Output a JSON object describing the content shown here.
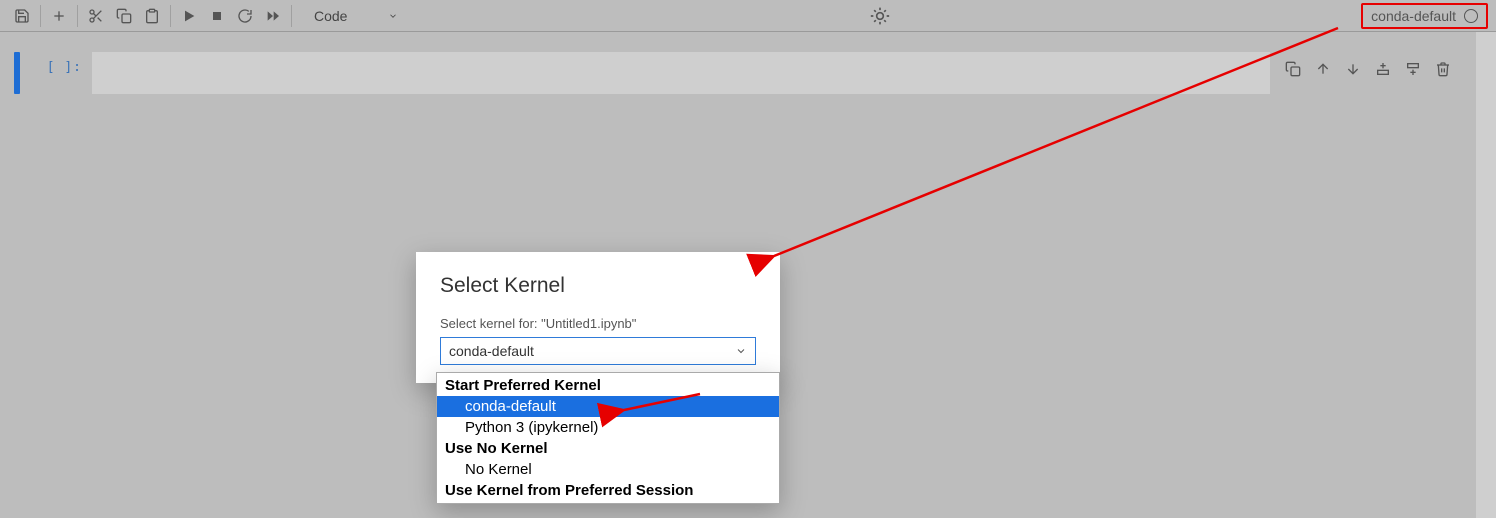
{
  "toolbar": {
    "cellTypeLabel": "Code"
  },
  "kernel": {
    "name": "conda-default"
  },
  "cell": {
    "prompt": "[ ]:",
    "code": ""
  },
  "dialog": {
    "title": "Select Kernel",
    "promptPrefix": "Select kernel for: \"",
    "notebookName": "Untitled1.ipynb",
    "promptSuffix": "\"",
    "selectValue": "conda-default",
    "groups": [
      {
        "header": "Start Preferred Kernel",
        "items": [
          "conda-default",
          "Python 3 (ipykernel)"
        ],
        "selectedIndex": 0
      },
      {
        "header": "Use No Kernel",
        "items": [
          "No Kernel"
        ],
        "selectedIndex": -1
      },
      {
        "header": "Use Kernel from Preferred Session",
        "items": [],
        "selectedIndex": -1
      }
    ]
  }
}
